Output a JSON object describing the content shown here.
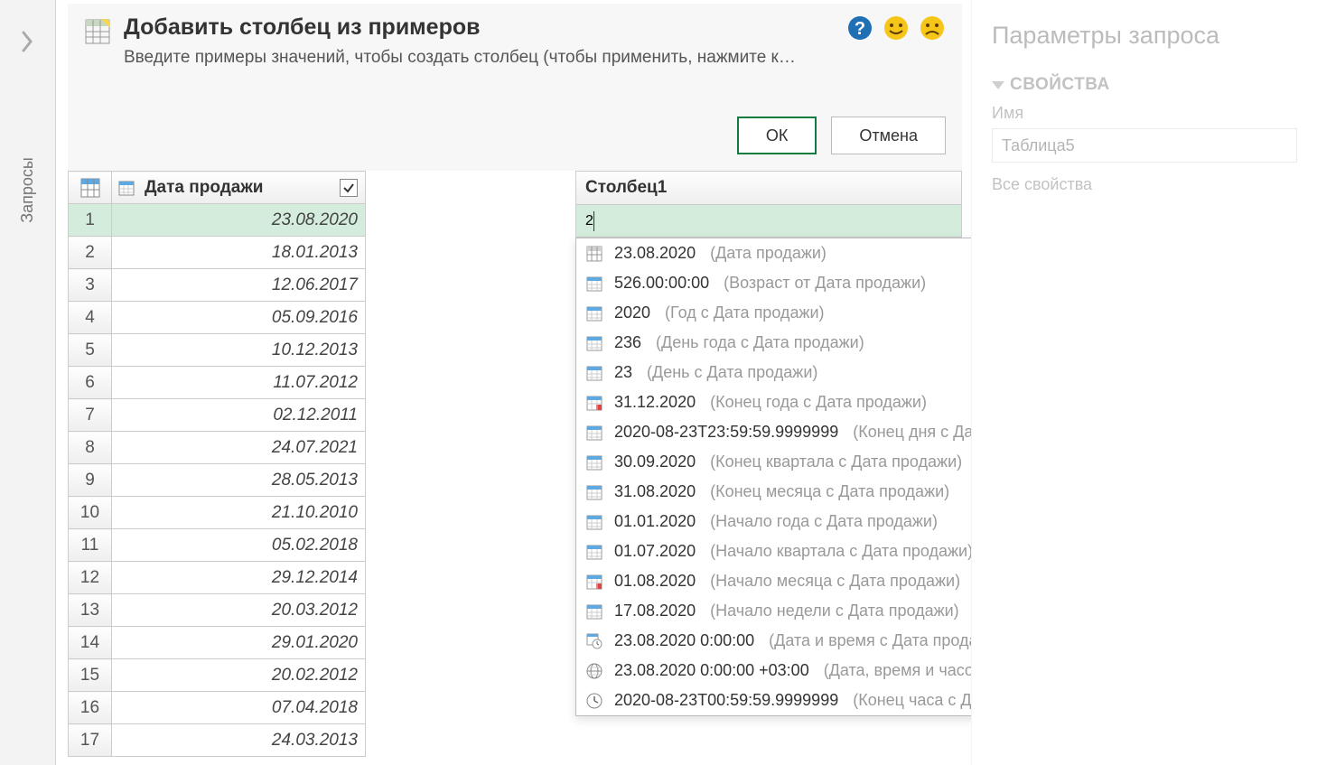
{
  "sidebar": {
    "label": "Запросы"
  },
  "header": {
    "title": "Добавить столбец из примеров",
    "description": "Введите примеры значений, чтобы создать столбец (чтобы применить, нажмите к…",
    "ok_label": "ОК",
    "cancel_label": "Отмена"
  },
  "source_column": {
    "name": "Дата продажи",
    "checked": true,
    "rows": [
      "23.08.2020",
      "18.01.2013",
      "12.06.2017",
      "05.09.2016",
      "10.12.2013",
      "11.07.2012",
      "02.12.2011",
      "24.07.2021",
      "28.05.2013",
      "21.10.2010",
      "05.02.2018",
      "29.12.2014",
      "20.03.2012",
      "29.01.2020",
      "20.02.2012",
      "07.04.2018",
      "24.03.2013"
    ]
  },
  "new_column": {
    "name": "Столбец1",
    "input_value": "2"
  },
  "suggestions": [
    {
      "icon": "table",
      "value": "23.08.2020",
      "hint": "(Дата продажи)"
    },
    {
      "icon": "calendar",
      "value": "526.00:00:00",
      "hint": "(Возраст от Дата продажи)"
    },
    {
      "icon": "calendar",
      "value": "2020",
      "hint": "(Год с Дата продажи)"
    },
    {
      "icon": "calendar",
      "value": "236",
      "hint": "(День года с Дата продажи)"
    },
    {
      "icon": "calendar",
      "value": "23",
      "hint": "(День с Дата продажи)"
    },
    {
      "icon": "calendar-red",
      "value": "31.12.2020",
      "hint": "(Конец года с Дата продажи)"
    },
    {
      "icon": "calendar",
      "value": "2020-08-23T23:59:59.9999999",
      "hint": "(Конец дня с Дата продажи)"
    },
    {
      "icon": "calendar",
      "value": "30.09.2020",
      "hint": "(Конец квартала с Дата продажи)"
    },
    {
      "icon": "calendar",
      "value": "31.08.2020",
      "hint": "(Конец месяца с Дата продажи)"
    },
    {
      "icon": "calendar",
      "value": "01.01.2020",
      "hint": "(Начало года с Дата продажи)"
    },
    {
      "icon": "calendar",
      "value": "01.07.2020",
      "hint": "(Начало квартала с Дата продажи)"
    },
    {
      "icon": "calendar-red",
      "value": "01.08.2020",
      "hint": "(Начало месяца с Дата продажи)"
    },
    {
      "icon": "calendar",
      "value": "17.08.2020",
      "hint": "(Начало недели с Дата продажи)"
    },
    {
      "icon": "datetime",
      "value": "23.08.2020 0:00:00",
      "hint": "(Дата и время с Дата продажи)"
    },
    {
      "icon": "globe",
      "value": "23.08.2020 0:00:00 +03:00",
      "hint": "(Дата, время и часовой пояс с Дата продажи)"
    },
    {
      "icon": "clock",
      "value": "2020-08-23T00:59:59.9999999",
      "hint": "(Конец часа с Дата продажи)"
    }
  ],
  "right_panel": {
    "title": "Параметры запроса",
    "section_label": "СВОЙСТВА",
    "name_label": "Имя",
    "name_value": "Таблица5",
    "all_props_link": "Все свойства"
  }
}
